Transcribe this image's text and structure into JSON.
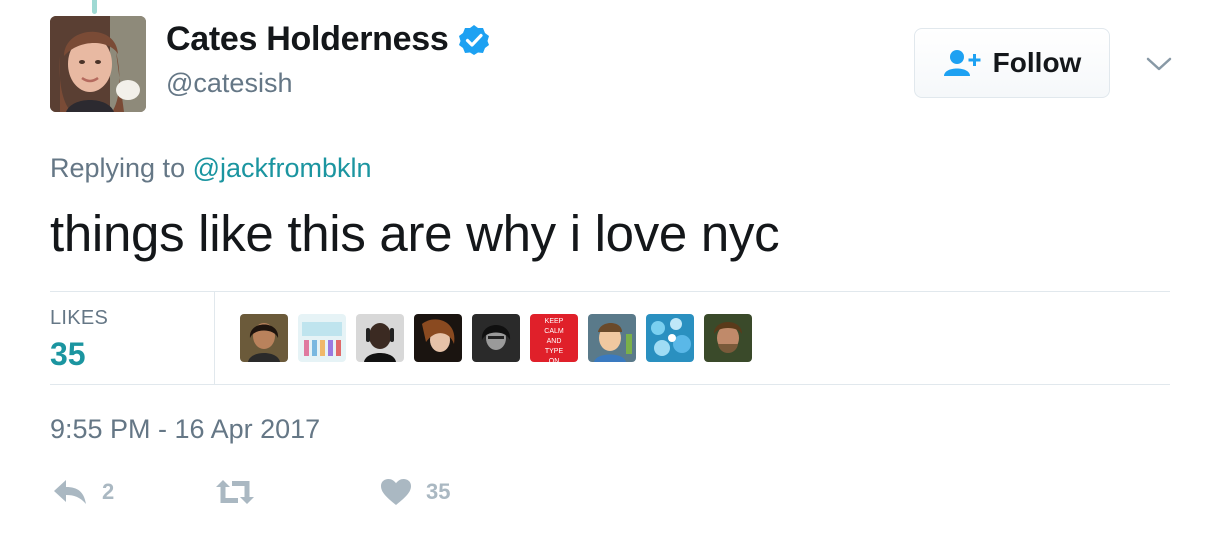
{
  "author": {
    "display_name": "Cates Holderness",
    "handle": "@catesish",
    "verified": true,
    "avatar_icon": "user-avatar"
  },
  "follow_button": {
    "label": "Follow",
    "icon": "add-user-icon"
  },
  "more_menu": {
    "icon": "chevron-down-icon"
  },
  "reply_context": {
    "prefix": "Replying to",
    "mention": "@jackfrombkln"
  },
  "tweet": {
    "text": "things like this are why i love nyc",
    "timestamp": "9:55 PM - 16 Apr 2017"
  },
  "stats": {
    "likes_label": "LIKES",
    "likes_count": "35",
    "liker_avatars": [
      {
        "name": "liker-avatar-1"
      },
      {
        "name": "liker-avatar-2"
      },
      {
        "name": "liker-avatar-3"
      },
      {
        "name": "liker-avatar-4"
      },
      {
        "name": "liker-avatar-5"
      },
      {
        "name": "liker-avatar-6",
        "text": "KEEP CALM AND TYPE ON"
      },
      {
        "name": "liker-avatar-7"
      },
      {
        "name": "liker-avatar-8"
      },
      {
        "name": "liker-avatar-9"
      }
    ]
  },
  "actions": {
    "reply_count": "2",
    "retweet_count": "",
    "like_count": "35"
  },
  "colors": {
    "accent": "#1b95a0",
    "text": "#14171a",
    "muted": "#657786",
    "icon": "#aab8c2",
    "verified": "#1da1f2",
    "follow_icon": "#1da1f2"
  }
}
